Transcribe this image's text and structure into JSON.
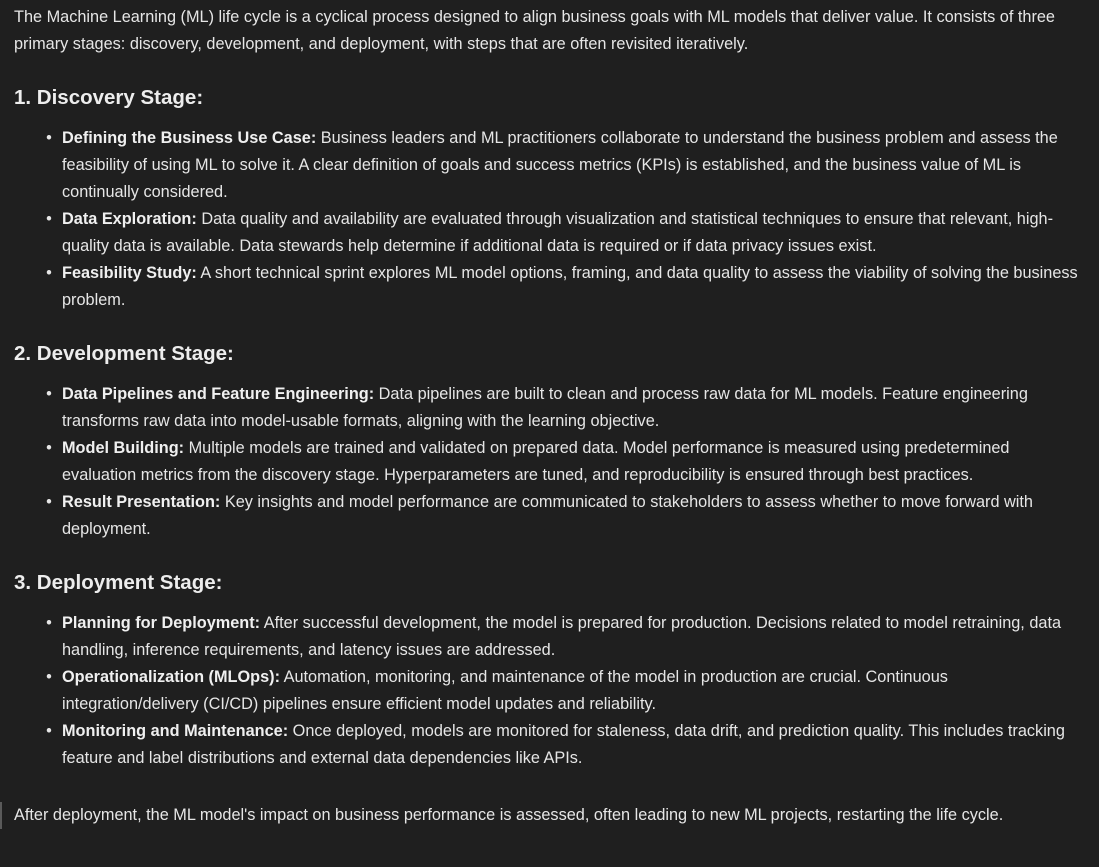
{
  "intro": "The Machine Learning (ML) life cycle is a cyclical process designed to align business goals with ML models that deliver value. It consists of three primary stages: discovery, development, and deployment, with steps that are often revisited iteratively.",
  "sections": [
    {
      "heading": "1. Discovery Stage:",
      "items": [
        {
          "term": "Defining the Business Use Case:",
          "text": " Business leaders and ML practitioners collaborate to understand the business problem and assess the feasibility of using ML to solve it. A clear definition of goals and success metrics (KPIs) is established, and the business value of ML is continually considered."
        },
        {
          "term": "Data Exploration:",
          "text": " Data quality and availability are evaluated through visualization and statistical techniques to ensure that relevant, high-quality data is available. Data stewards help determine if additional data is required or if data privacy issues exist."
        },
        {
          "term": "Feasibility Study:",
          "text": " A short technical sprint explores ML model options, framing, and data quality to assess the viability of solving the business problem."
        }
      ]
    },
    {
      "heading": "2. Development Stage:",
      "items": [
        {
          "term": "Data Pipelines and Feature Engineering:",
          "text": " Data pipelines are built to clean and process raw data for ML models. Feature engineering transforms raw data into model-usable formats, aligning with the learning objective."
        },
        {
          "term": "Model Building:",
          "text": " Multiple models are trained and validated on prepared data. Model performance is measured using predetermined evaluation metrics from the discovery stage. Hyperparameters are tuned, and reproducibility is ensured through best practices."
        },
        {
          "term": "Result Presentation:",
          "text": " Key insights and model performance are communicated to stakeholders to assess whether to move forward with deployment."
        }
      ]
    },
    {
      "heading": "3. Deployment Stage:",
      "items": [
        {
          "term": "Planning for Deployment:",
          "text": " After successful development, the model is prepared for production. Decisions related to model retraining, data handling, inference requirements, and latency issues are addressed."
        },
        {
          "term": "Operationalization (MLOps):",
          "text": " Automation, monitoring, and maintenance of the model in production are crucial. Continuous integration/delivery (CI/CD) pipelines ensure efficient model updates and reliability."
        },
        {
          "term": "Monitoring and Maintenance:",
          "text": " Once deployed, models are monitored for staleness, data drift, and prediction quality. This includes tracking feature and label distributions and external data dependencies like APIs."
        }
      ]
    }
  ],
  "closing": "After deployment, the ML model's impact on business performance is assessed, often leading to new ML projects, restarting the life cycle.",
  "colors": {
    "background": "#1f1f1f",
    "text": "#e6e6e6",
    "quote_border": "#5a5a5a"
  }
}
